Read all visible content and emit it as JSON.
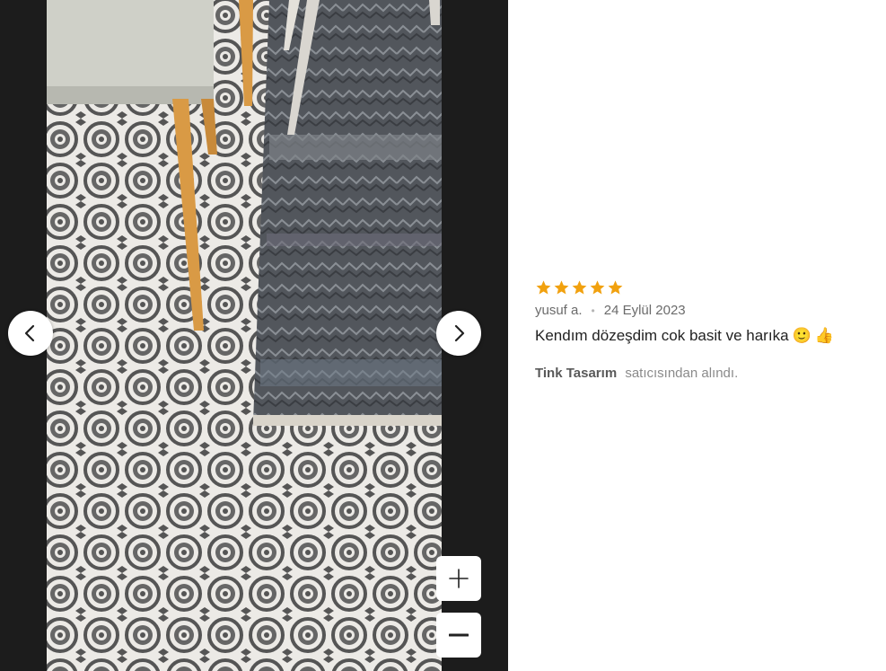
{
  "viewer": {
    "photo_description_icon": "tile-floor-photo",
    "prev_icon": "chevron-left-icon",
    "next_icon": "chevron-right-icon",
    "zoom_in_icon": "plus-icon",
    "zoom_out_icon": "minus-icon"
  },
  "review": {
    "rating": 5,
    "rating_max": 5,
    "star_color": "#f1a10f",
    "author": "yusuf a.",
    "separator": "•",
    "date": "24 Eylül 2023",
    "text": "Kendım dözeşdim cok basit ve harıka",
    "emojis": [
      "🙂",
      "👍"
    ],
    "seller_name": "Tink Tasarım",
    "seller_suffix": "satıcısından alındı."
  }
}
